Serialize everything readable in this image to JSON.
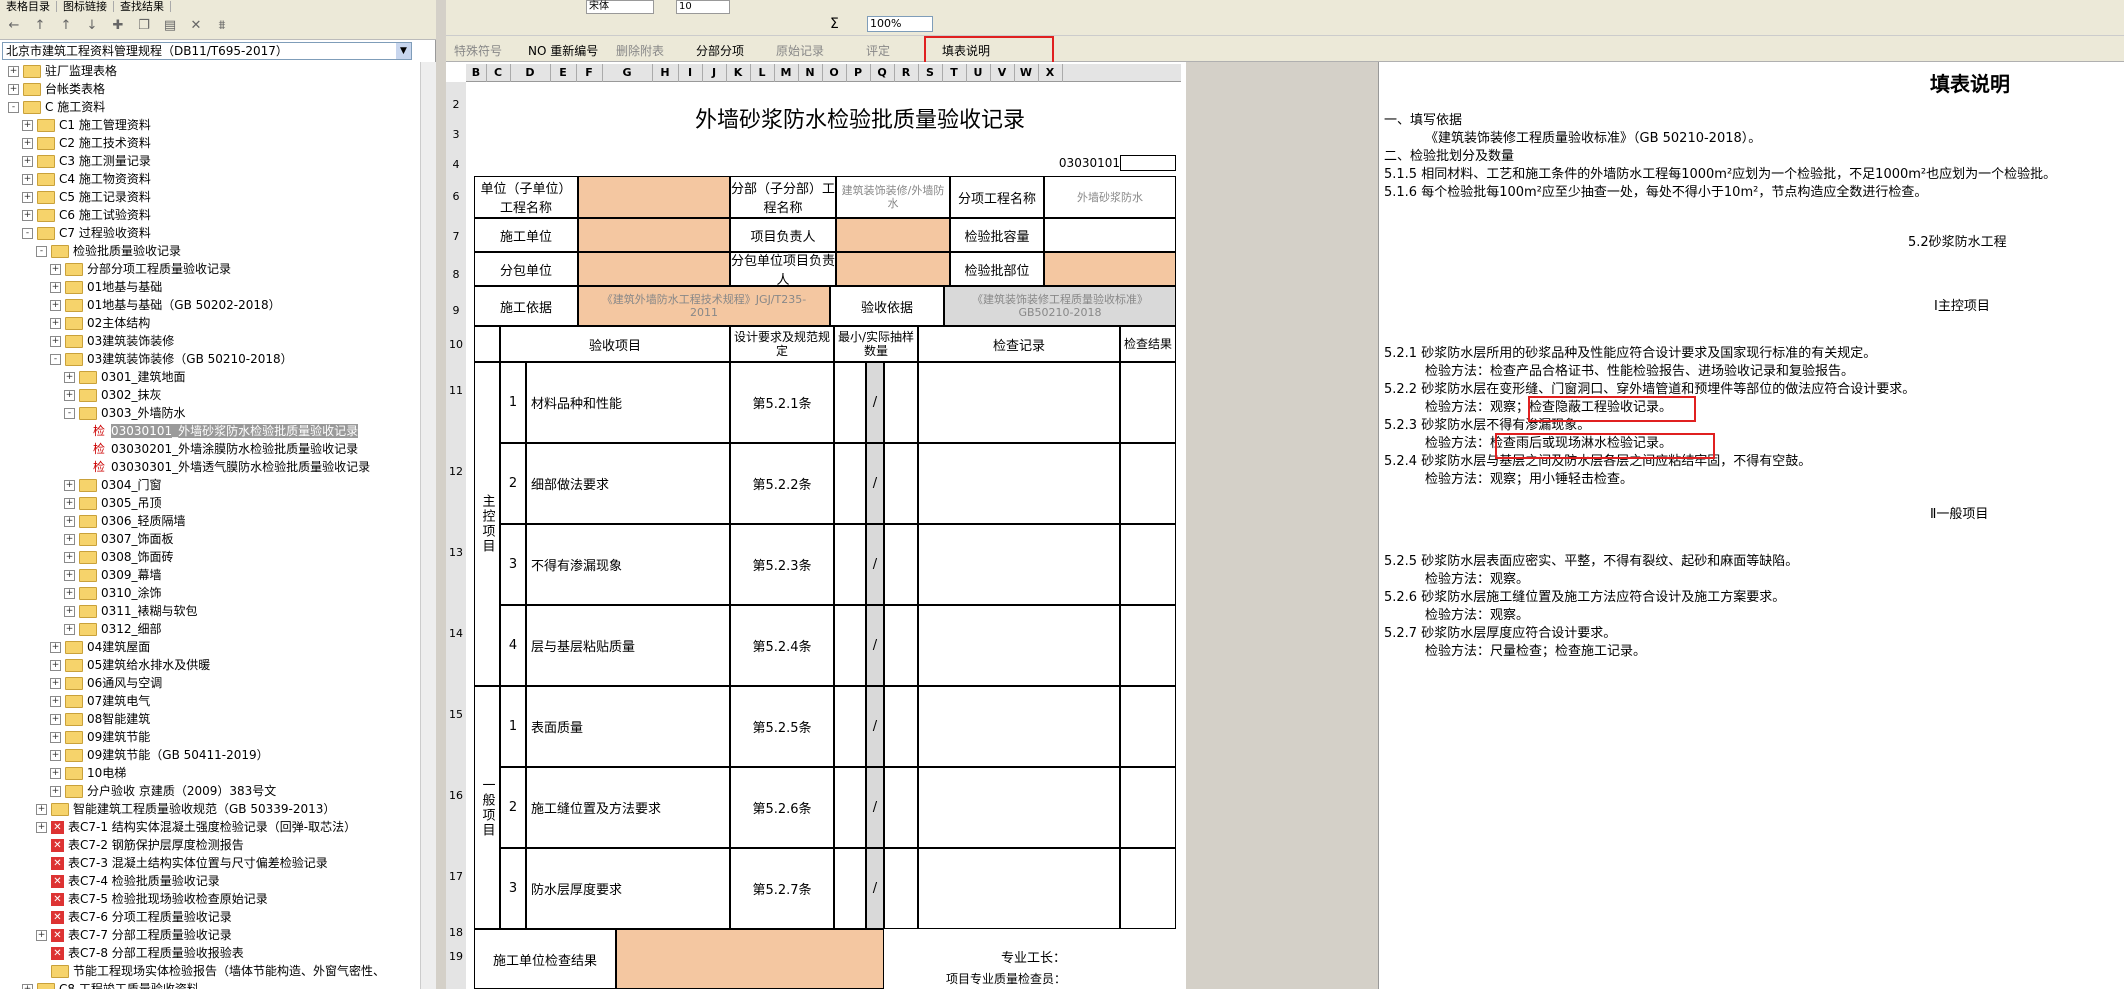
{
  "left_panel": {
    "tabs": [
      "表格目录",
      "图标链接",
      "查找结果"
    ],
    "catalog_combo": "北京市建筑工程资料管理规程（DB11/T695-2017）",
    "tree": [
      {
        "label": "驻厂监理表格",
        "level": 0,
        "exp": "+"
      },
      {
        "label": "台帐类表格",
        "level": 0,
        "exp": "+"
      },
      {
        "label": "C 施工资料",
        "level": 0,
        "exp": "-"
      },
      {
        "label": "C1 施工管理资料",
        "level": 1,
        "exp": "+"
      },
      {
        "label": "C2 施工技术资料",
        "level": 1,
        "exp": "+"
      },
      {
        "label": "C3 施工测量记录",
        "level": 1,
        "exp": "+"
      },
      {
        "label": "C4 施工物资资料",
        "level": 1,
        "exp": "+"
      },
      {
        "label": "C5 施工记录资料",
        "level": 1,
        "exp": "+"
      },
      {
        "label": "C6 施工试验资料",
        "level": 1,
        "exp": "+"
      },
      {
        "label": "C7 过程验收资料",
        "level": 1,
        "exp": "-"
      },
      {
        "label": "检验批质量验收记录",
        "level": 2,
        "exp": "-"
      },
      {
        "label": "分部分项工程质量验收记录",
        "level": 3,
        "exp": "+"
      },
      {
        "label": "01地基与基础",
        "level": 3,
        "exp": "+"
      },
      {
        "label": "01地基与基础（GB 50202-2018）",
        "level": 3,
        "exp": "+"
      },
      {
        "label": "02主体结构",
        "level": 3,
        "exp": "+"
      },
      {
        "label": "03建筑装饰装修",
        "level": 3,
        "exp": "+"
      },
      {
        "label": "03建筑装饰装修（GB 50210-2018）",
        "level": 3,
        "exp": "-"
      },
      {
        "label": "0301_建筑地面",
        "level": 4,
        "exp": "+"
      },
      {
        "label": "0302_抹灰",
        "level": 4,
        "exp": "+"
      },
      {
        "label": "0303_外墙防水",
        "level": 4,
        "exp": "-"
      },
      {
        "label": "03030101_外墙砂浆防水检验批质量验收记录",
        "level": 5,
        "exp": "",
        "leaf": true,
        "selected": true
      },
      {
        "label": "03030201_外墙涂膜防水检验批质量验收记录",
        "level": 5,
        "exp": "",
        "leaf": true
      },
      {
        "label": "03030301_外墙透气膜防水检验批质量验收记录",
        "level": 5,
        "exp": "",
        "leaf": true
      },
      {
        "label": "0304_门窗",
        "level": 4,
        "exp": "+"
      },
      {
        "label": "0305_吊顶",
        "level": 4,
        "exp": "+"
      },
      {
        "label": "0306_轻质隔墙",
        "level": 4,
        "exp": "+"
      },
      {
        "label": "0307_饰面板",
        "level": 4,
        "exp": "+"
      },
      {
        "label": "0308_饰面砖",
        "level": 4,
        "exp": "+"
      },
      {
        "label": "0309_幕墙",
        "level": 4,
        "exp": "+"
      },
      {
        "label": "0310_涂饰",
        "level": 4,
        "exp": "+"
      },
      {
        "label": "0311_裱糊与软包",
        "level": 4,
        "exp": "+"
      },
      {
        "label": "0312_细部",
        "level": 4,
        "exp": "+"
      },
      {
        "label": "04建筑屋面",
        "level": 3,
        "exp": "+"
      },
      {
        "label": "05建筑给水排水及供暖",
        "level": 3,
        "exp": "+"
      },
      {
        "label": "06通风与空调",
        "level": 3,
        "exp": "+"
      },
      {
        "label": "07建筑电气",
        "level": 3,
        "exp": "+"
      },
      {
        "label": "08智能建筑",
        "level": 3,
        "exp": "+"
      },
      {
        "label": "09建筑节能",
        "level": 3,
        "exp": "+"
      },
      {
        "label": "09建筑节能（GB 50411-2019）",
        "level": 3,
        "exp": "+"
      },
      {
        "label": "10电梯",
        "level": 3,
        "exp": "+"
      },
      {
        "label": "分户验收 京建质（2009）383号文",
        "level": 3,
        "exp": "+"
      },
      {
        "label": "智能建筑工程质量验收规范（GB 50339-2013）",
        "level": 2,
        "exp": "+"
      },
      {
        "label": "表C7-1 结构实体混凝土强度检验记录（回弹-取芯法）",
        "level": 2,
        "exp": "+",
        "xicon": true
      },
      {
        "label": "表C7-2 钢筋保护层厚度检测报告",
        "level": 2,
        "exp": "",
        "xicon": true
      },
      {
        "label": "表C7-3 混凝土结构实体位置与尺寸偏差检验记录",
        "level": 2,
        "exp": "",
        "xicon": true
      },
      {
        "label": "表C7-4 检验批质量验收记录",
        "level": 2,
        "exp": "",
        "xicon": true
      },
      {
        "label": "表C7-5 检验批现场验收检查原始记录",
        "level": 2,
        "exp": "",
        "xicon": true
      },
      {
        "label": "表C7-6 分项工程质量验收记录",
        "level": 2,
        "exp": "",
        "xicon": true
      },
      {
        "label": "表C7-7 分部工程质量验收记录",
        "level": 2,
        "exp": "+",
        "xicon": true
      },
      {
        "label": "表C7-8 分部工程质量验收报验表",
        "level": 2,
        "exp": "",
        "xicon": true
      },
      {
        "label": "节能工程现场实体检验报告（墙体节能构造、外窗气密性、",
        "level": 2,
        "exp": ""
      },
      {
        "label": "C8 工程竣工质量验收资料",
        "level": 1,
        "exp": "+"
      }
    ]
  },
  "toolbar": {
    "font_name": "宋体",
    "font_size": "10",
    "zoom": "100%",
    "sigma": "Σ",
    "row3": [
      "特殊符号",
      "NO 重新编号",
      "删除附表",
      "分部分项",
      "原始记录",
      "评定",
      "填表说明"
    ]
  },
  "sheet": {
    "col_headers": [
      "B",
      "C",
      "D",
      "E",
      "F",
      "G",
      "H",
      "I",
      "J",
      "K",
      "L",
      "M",
      "N",
      "O",
      "P",
      "Q",
      "R",
      "S",
      "T",
      "U",
      "V",
      "W",
      "X"
    ],
    "row_headers": [
      "2",
      "3",
      "4",
      "6",
      "7",
      "8",
      "9",
      "10",
      "11",
      "12",
      "13",
      "14",
      "15",
      "16",
      "17",
      "18",
      "19"
    ],
    "title": "外墙砂浆防水检验批质量验收记录",
    "code": "03030101",
    "r6": {
      "unit_label": "单位（子单位）工程名称",
      "sub_label": "分部（子分部）工程名称",
      "sub_value": "建筑装饰装修/外墙防水",
      "item_label": "分项工程名称",
      "item_value": "外墙砂浆防水"
    },
    "r7": {
      "contractor_label": "施工单位",
      "pm_label": "项目负责人",
      "capacity_label": "检验批容量"
    },
    "r8": {
      "sub_label": "分包单位",
      "sub_pm_label": "分包单位项目负责人",
      "part_label": "检验批部位"
    },
    "r9": {
      "basis_label": "施工依据",
      "basis_value": "《建筑外墙防水工程技术规程》JGJ/T235-2011",
      "accept_label": "验收依据",
      "accept_value": "《建筑装饰装修工程质量验收标准》GB50210-2018"
    },
    "r10": {
      "item": "验收项目",
      "design": "设计要求及规范规定",
      "min": "最小/实际抽样数量",
      "record": "检查记录",
      "result": "检查结果"
    },
    "main_group": "主控项目",
    "general_group": "一般项目",
    "main_items": [
      {
        "no": "1",
        "name": "材料品种和性能",
        "rule": "第5.2.1条",
        "sample": "/"
      },
      {
        "no": "2",
        "name": "细部做法要求",
        "rule": "第5.2.2条",
        "sample": "/"
      },
      {
        "no": "3",
        "name": "不得有渗漏现象",
        "rule": "第5.2.3条",
        "sample": "/"
      },
      {
        "no": "4",
        "name": "层与基层粘贴质量",
        "rule": "第5.2.4条",
        "sample": "/"
      }
    ],
    "general_items": [
      {
        "no": "1",
        "name": "表面质量",
        "rule": "第5.2.5条",
        "sample": "/"
      },
      {
        "no": "2",
        "name": "施工缝位置及方法要求",
        "rule": "第5.2.6条",
        "sample": "/"
      },
      {
        "no": "3",
        "name": "防水层厚度要求",
        "rule": "第5.2.7条",
        "sample": "/"
      }
    ],
    "r19": {
      "contractor_result": "施工单位检查结果",
      "foreman": "专业工长：",
      "qc": "项目专业质量检查员："
    }
  },
  "description": {
    "title": "填表说明",
    "lines": [
      {
        "text": "一、填写依据",
        "indent": false
      },
      {
        "text": "《建筑装饰装修工程质量验收标准》（GB 50210-2018）。",
        "indent": true
      },
      {
        "text": "二、检验批划分及数量",
        "indent": false
      },
      {
        "text": "5.1.5 相同材料、工艺和施工条件的外墙防水工程每1000m²应划为一个检验批，不足1000m²也应划为一个检验批。",
        "indent": false
      },
      {
        "text": "5.1.6 每个检验批每100m²应至少抽查一处，每处不得小于10m²，节点构造应全数进行检查。",
        "indent": false
      }
    ],
    "section_heading": "5.2砂浆防水工程",
    "main_heading": "Ⅰ主控项目",
    "main_lines": [
      {
        "text": "5.2.1 砂浆防水层所用的砂浆品种及性能应符合设计要求及国家现行标准的有关规定。",
        "indent": false
      },
      {
        "text": "检验方法：检查产品合格证书、性能检验报告、进场验收记录和复验报告。",
        "indent": true
      },
      {
        "text": "5.2.2 砂浆防水层在变形缝、门窗洞口、穿外墙管道和预埋件等部位的做法应符合设计要求。",
        "indent": false
      },
      {
        "text": "检验方法：观察；检查隐蔽工程验收记录。",
        "indent": true
      },
      {
        "text": "5.2.3 砂浆防水层不得有渗漏现象。",
        "indent": false
      },
      {
        "text": "检验方法：检查雨后或现场淋水检验记录。",
        "indent": true
      },
      {
        "text": "5.2.4 砂浆防水层与基层之间及防水层各层之间应粘结牢固，不得有空鼓。",
        "indent": false
      },
      {
        "text": "检验方法：观察；用小锤轻击检查。",
        "indent": true
      }
    ],
    "general_heading": "Ⅱ一般项目",
    "general_lines": [
      {
        "text": "5.2.5 砂浆防水层表面应密实、平整，不得有裂纹、起砂和麻面等缺陷。",
        "indent": false
      },
      {
        "text": "检验方法：观察。",
        "indent": true
      },
      {
        "text": "5.2.6 砂浆防水层施工缝位置及施工方法应符合设计及施工方案要求。",
        "indent": false
      },
      {
        "text": "检验方法：观察。",
        "indent": true
      },
      {
        "text": "5.2.7 砂浆防水层厚度应符合设计要求。",
        "indent": false
      },
      {
        "text": "检验方法：尺量检查；检查施工记录。",
        "indent": true
      }
    ]
  },
  "colors": {
    "highlight": "#e02020",
    "orange_cell": "#f4c7a1",
    "selected": "#9a9a9a"
  }
}
